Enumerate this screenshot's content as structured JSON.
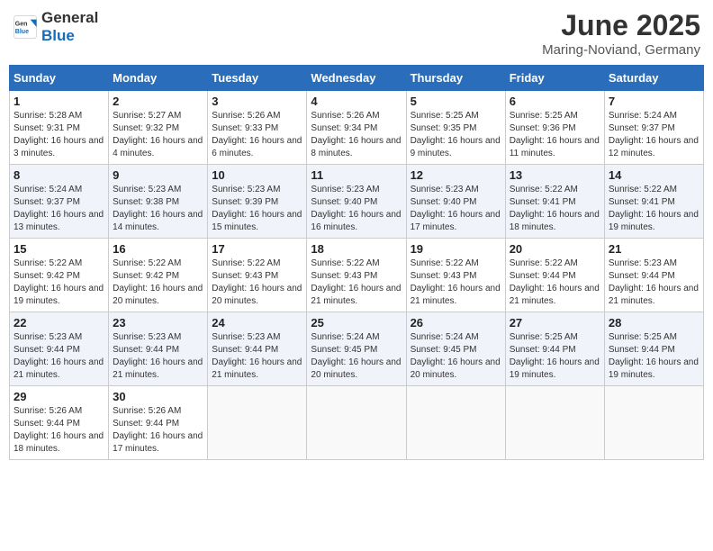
{
  "header": {
    "logo_general": "General",
    "logo_blue": "Blue",
    "title": "June 2025",
    "subtitle": "Maring-Noviand, Germany"
  },
  "days_of_week": [
    "Sunday",
    "Monday",
    "Tuesday",
    "Wednesday",
    "Thursday",
    "Friday",
    "Saturday"
  ],
  "weeks": [
    [
      {
        "day": "1",
        "sunrise": "5:28 AM",
        "sunset": "9:31 PM",
        "daylight": "16 hours and 3 minutes."
      },
      {
        "day": "2",
        "sunrise": "5:27 AM",
        "sunset": "9:32 PM",
        "daylight": "16 hours and 4 minutes."
      },
      {
        "day": "3",
        "sunrise": "5:26 AM",
        "sunset": "9:33 PM",
        "daylight": "16 hours and 6 minutes."
      },
      {
        "day": "4",
        "sunrise": "5:26 AM",
        "sunset": "9:34 PM",
        "daylight": "16 hours and 8 minutes."
      },
      {
        "day": "5",
        "sunrise": "5:25 AM",
        "sunset": "9:35 PM",
        "daylight": "16 hours and 9 minutes."
      },
      {
        "day": "6",
        "sunrise": "5:25 AM",
        "sunset": "9:36 PM",
        "daylight": "16 hours and 11 minutes."
      },
      {
        "day": "7",
        "sunrise": "5:24 AM",
        "sunset": "9:37 PM",
        "daylight": "16 hours and 12 minutes."
      }
    ],
    [
      {
        "day": "8",
        "sunrise": "5:24 AM",
        "sunset": "9:37 PM",
        "daylight": "16 hours and 13 minutes."
      },
      {
        "day": "9",
        "sunrise": "5:23 AM",
        "sunset": "9:38 PM",
        "daylight": "16 hours and 14 minutes."
      },
      {
        "day": "10",
        "sunrise": "5:23 AM",
        "sunset": "9:39 PM",
        "daylight": "16 hours and 15 minutes."
      },
      {
        "day": "11",
        "sunrise": "5:23 AM",
        "sunset": "9:40 PM",
        "daylight": "16 hours and 16 minutes."
      },
      {
        "day": "12",
        "sunrise": "5:23 AM",
        "sunset": "9:40 PM",
        "daylight": "16 hours and 17 minutes."
      },
      {
        "day": "13",
        "sunrise": "5:22 AM",
        "sunset": "9:41 PM",
        "daylight": "16 hours and 18 minutes."
      },
      {
        "day": "14",
        "sunrise": "5:22 AM",
        "sunset": "9:41 PM",
        "daylight": "16 hours and 19 minutes."
      }
    ],
    [
      {
        "day": "15",
        "sunrise": "5:22 AM",
        "sunset": "9:42 PM",
        "daylight": "16 hours and 19 minutes."
      },
      {
        "day": "16",
        "sunrise": "5:22 AM",
        "sunset": "9:42 PM",
        "daylight": "16 hours and 20 minutes."
      },
      {
        "day": "17",
        "sunrise": "5:22 AM",
        "sunset": "9:43 PM",
        "daylight": "16 hours and 20 minutes."
      },
      {
        "day": "18",
        "sunrise": "5:22 AM",
        "sunset": "9:43 PM",
        "daylight": "16 hours and 21 minutes."
      },
      {
        "day": "19",
        "sunrise": "5:22 AM",
        "sunset": "9:43 PM",
        "daylight": "16 hours and 21 minutes."
      },
      {
        "day": "20",
        "sunrise": "5:22 AM",
        "sunset": "9:44 PM",
        "daylight": "16 hours and 21 minutes."
      },
      {
        "day": "21",
        "sunrise": "5:23 AM",
        "sunset": "9:44 PM",
        "daylight": "16 hours and 21 minutes."
      }
    ],
    [
      {
        "day": "22",
        "sunrise": "5:23 AM",
        "sunset": "9:44 PM",
        "daylight": "16 hours and 21 minutes."
      },
      {
        "day": "23",
        "sunrise": "5:23 AM",
        "sunset": "9:44 PM",
        "daylight": "16 hours and 21 minutes."
      },
      {
        "day": "24",
        "sunrise": "5:23 AM",
        "sunset": "9:44 PM",
        "daylight": "16 hours and 21 minutes."
      },
      {
        "day": "25",
        "sunrise": "5:24 AM",
        "sunset": "9:45 PM",
        "daylight": "16 hours and 20 minutes."
      },
      {
        "day": "26",
        "sunrise": "5:24 AM",
        "sunset": "9:45 PM",
        "daylight": "16 hours and 20 minutes."
      },
      {
        "day": "27",
        "sunrise": "5:25 AM",
        "sunset": "9:44 PM",
        "daylight": "16 hours and 19 minutes."
      },
      {
        "day": "28",
        "sunrise": "5:25 AM",
        "sunset": "9:44 PM",
        "daylight": "16 hours and 19 minutes."
      }
    ],
    [
      {
        "day": "29",
        "sunrise": "5:26 AM",
        "sunset": "9:44 PM",
        "daylight": "16 hours and 18 minutes."
      },
      {
        "day": "30",
        "sunrise": "5:26 AM",
        "sunset": "9:44 PM",
        "daylight": "16 hours and 17 minutes."
      },
      null,
      null,
      null,
      null,
      null
    ]
  ],
  "labels": {
    "sunrise": "Sunrise:",
    "sunset": "Sunset:",
    "daylight": "Daylight:"
  }
}
